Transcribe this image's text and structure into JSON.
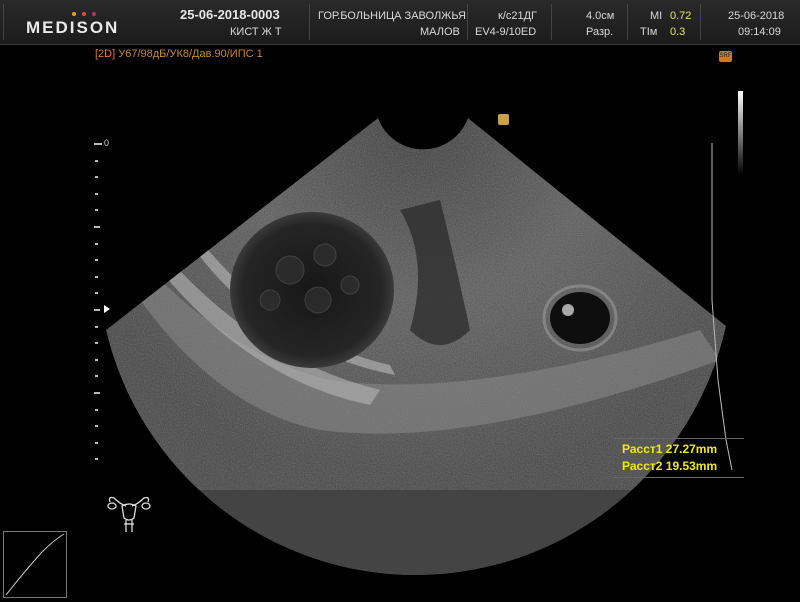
{
  "header": {
    "logo": "MEDISON",
    "exam_id": "25-06-2018-0003",
    "patient": "КИСТ Ж Т",
    "hospital": "ГОР.БОЛЬНИЦА ЗАВОЛЖЬЯ",
    "doctor": "МАЛОВ",
    "preset": "к/с21ДГ",
    "probe": "EV4-9/10ED",
    "depth": "4.0см",
    "res_label": "Разр.",
    "mi_label": "MI",
    "mi_value": "0.72",
    "ti_label": "TIм",
    "ti_value": "0.3",
    "date": "25-06-2018",
    "time": "09:14:09"
  },
  "status": {
    "mode": "[2D]",
    "params": "У67/98дБ/УК8/Дав.90/ИПС 1"
  },
  "depth_scale": {
    "zero_label": "0"
  },
  "markers": {
    "srf_label": "SRF"
  },
  "measurements": [
    {
      "label": "Расст1",
      "value": "27.27mm"
    },
    {
      "label": "Расст2",
      "value": "19.53mm"
    }
  ],
  "colors": {
    "accent_yellow": "#f0ea10",
    "status_orange": "#c58a2a",
    "logo_dot_1": "#e8a020",
    "logo_dot_2": "#e05030",
    "logo_dot_3": "#c03060"
  },
  "icons": {
    "body_marker": "uterus-icon",
    "tgc_curve": "tgc-curve-icon"
  }
}
